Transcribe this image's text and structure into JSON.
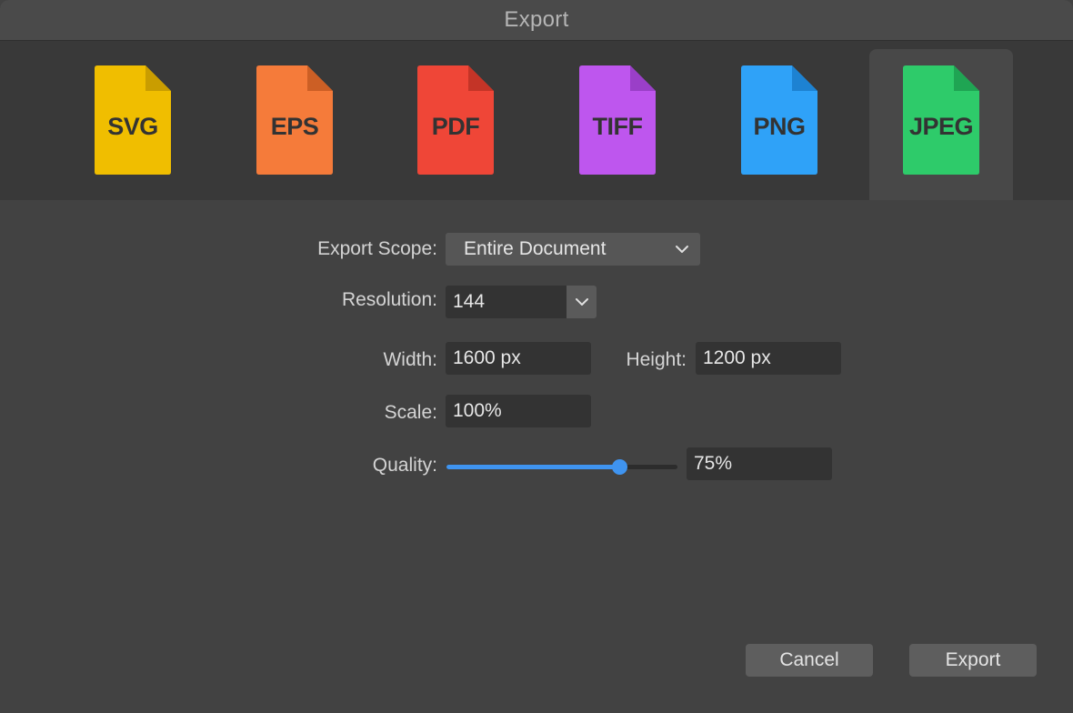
{
  "window": {
    "title": "Export"
  },
  "formats": [
    {
      "label": "SVG",
      "color": "#F0BE00",
      "fold": "#C99D00",
      "selected": false
    },
    {
      "label": "EPS",
      "color": "#F57B3A",
      "fold": "#CC5F25",
      "selected": false
    },
    {
      "label": "PDF",
      "color": "#EF4637",
      "fold": "#C43427",
      "selected": false
    },
    {
      "label": "TIFF",
      "color": "#BE56EE",
      "fold": "#9A3FC8",
      "selected": false
    },
    {
      "label": "PNG",
      "color": "#2FA2F8",
      "fold": "#1D82D2",
      "selected": false
    },
    {
      "label": "JPEG",
      "color": "#2ECB6A",
      "fold": "#1FA553",
      "selected": true
    }
  ],
  "form": {
    "export_scope": {
      "label": "Export Scope:",
      "value": "Entire Document"
    },
    "resolution": {
      "label": "Resolution:",
      "value": "144"
    },
    "width": {
      "label": "Width:",
      "value": "1600 px"
    },
    "height": {
      "label": "Height:",
      "value": "1200 px"
    },
    "scale": {
      "label": "Scale:",
      "value": "100%"
    },
    "quality": {
      "label": "Quality:",
      "value": "75%",
      "level": 0.75
    }
  },
  "buttons": {
    "cancel": "Cancel",
    "export": "Export"
  },
  "colors": {
    "accent": "#3F94F0"
  }
}
